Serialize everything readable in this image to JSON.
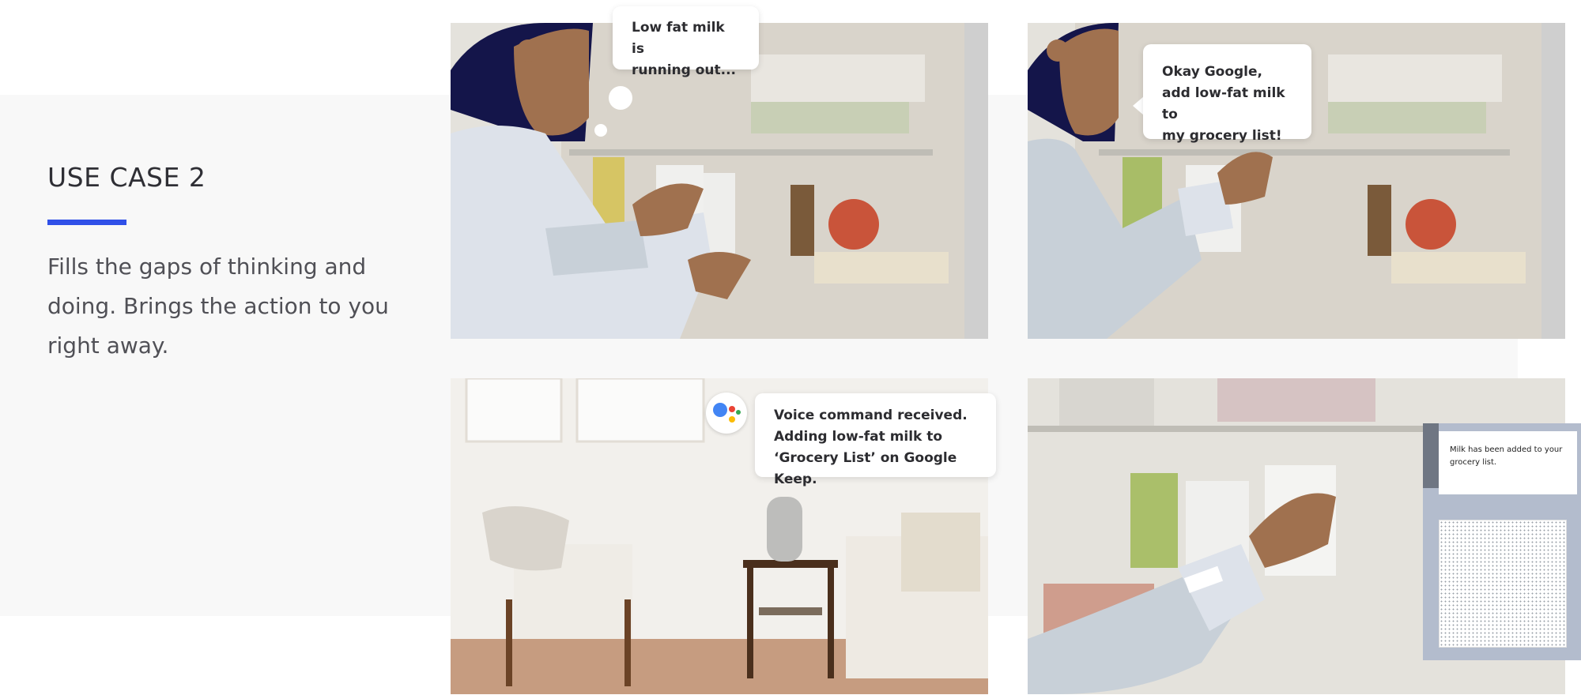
{
  "section": {
    "title": "USE CASE 2",
    "description": "Fills the gaps of thinking and doing. Brings the action to you right away.",
    "accent_color": "#3050e8"
  },
  "panels": [
    {
      "bubble_text": "Low fat milk is\nrunning out..."
    },
    {
      "bubble_text": "Okay Google,\nadd low-fat milk to\nmy grocery list!"
    },
    {
      "bubble_text": "Voice command received.\nAdding low-fat milk to\n‘Grocery List’ on Google Keep."
    },
    {
      "notification_text": "Milk has been added to your grocery list."
    }
  ],
  "icons": {
    "assistant": "google-assistant-icon"
  },
  "colors": {
    "hair": "#14154a",
    "skin": "#a0714f",
    "sleeve": "#c8d0d8",
    "phone_frame": "#b3bccd"
  }
}
